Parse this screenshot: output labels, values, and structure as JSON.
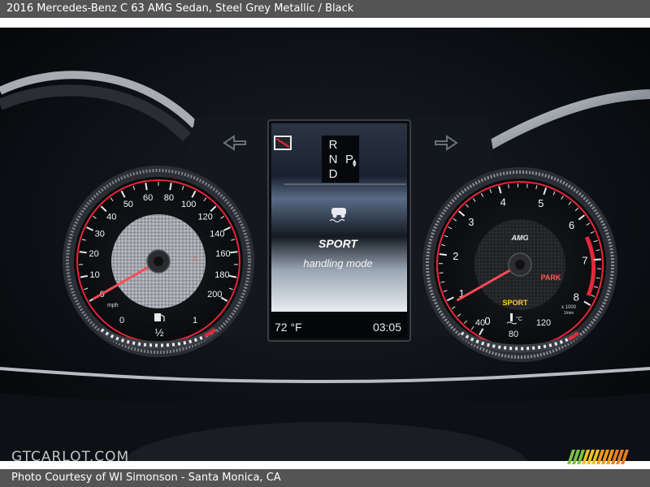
{
  "caption": {
    "title": "2016 Mercedes-Benz C 63 AMG Sedan,  Steel Grey Metallic / Black",
    "credit": "Photo Courtesy of WI Simonson - Santa Monica, CA",
    "watermark": "GTCARLOT.COM"
  },
  "speedometer": {
    "ticks": [
      "0",
      "10",
      "20",
      "30",
      "40",
      "50",
      "60",
      "80",
      "100",
      "120",
      "140",
      "160",
      "180",
      "200"
    ],
    "unit": "mph",
    "needle_value_mph": 0,
    "fuel": {
      "empty_label": "0",
      "half_label": "½",
      "full_label": "1",
      "level": 0.55
    }
  },
  "display": {
    "gears": [
      "R",
      "N",
      "D"
    ],
    "park_label": "P",
    "mode_title": "SPORT",
    "mode_subtitle": "handling mode",
    "temperature": "72 °F",
    "clock": "03:05"
  },
  "tachometer": {
    "ticks": [
      "0",
      "1",
      "2",
      "3",
      "4",
      "5",
      "6",
      "7",
      "8"
    ],
    "brand": "AMG",
    "unit_line1": "x 1000",
    "unit_line2": "1/min",
    "park_label": "PARK",
    "sport_label": "SPORT",
    "needle_value_krpm": 0.9,
    "coolant": {
      "low_label": "40",
      "mid_label": "80",
      "high_label": "120",
      "unit": "°C"
    }
  },
  "colors": {
    "accent_red": "#e8253a",
    "needle_red": "#ff4a5a",
    "park_red": "#ff5a4a",
    "sport_yellow": "#ffcc33",
    "bar_grey": "#545454",
    "stripe_colors": [
      "#7bc043",
      "#f0c419",
      "#f39c12",
      "#e67e22"
    ]
  }
}
